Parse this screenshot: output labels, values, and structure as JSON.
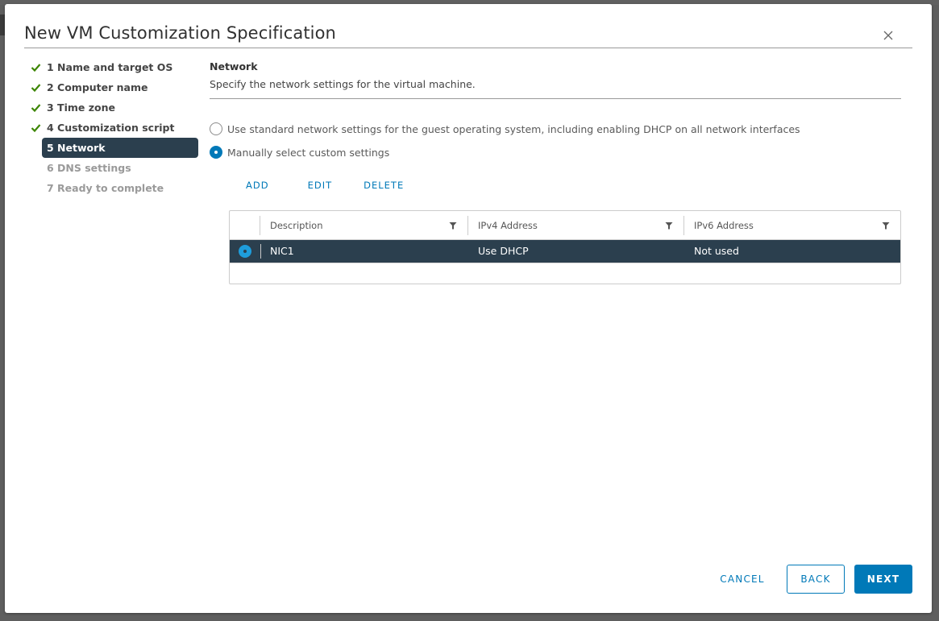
{
  "dialog": {
    "title": "New VM Customization Specification",
    "close_icon": "close-icon"
  },
  "steps": [
    {
      "label": "1 Name and target OS",
      "status": "complete"
    },
    {
      "label": "2 Computer name",
      "status": "complete"
    },
    {
      "label": "3 Time zone",
      "status": "complete"
    },
    {
      "label": "4 Customization script",
      "status": "complete"
    },
    {
      "label": "5 Network",
      "status": "active"
    },
    {
      "label": "6 DNS settings",
      "status": "disabled"
    },
    {
      "label": "7 Ready to complete",
      "status": "disabled"
    }
  ],
  "section": {
    "title": "Network",
    "description": "Specify the network settings for the virtual machine."
  },
  "options": [
    {
      "label": "Use standard network settings for the guest operating system, including enabling DHCP on all network interfaces",
      "checked": false
    },
    {
      "label": "Manually select custom settings",
      "checked": true
    }
  ],
  "actions": {
    "add": "ADD",
    "edit": "EDIT",
    "delete": "DELETE"
  },
  "grid": {
    "columns": [
      "Description",
      "IPv4 Address",
      "IPv6 Address"
    ],
    "rows": [
      {
        "selected": true,
        "description": "NIC1",
        "ipv4": "Use DHCP",
        "ipv6": "Not used"
      }
    ]
  },
  "footer": {
    "cancel": "CANCEL",
    "back": "BACK",
    "next": "NEXT"
  },
  "colors": {
    "accent": "#0079b8",
    "active_step_bg": "#2b3f4e",
    "check_green": "#3c8500"
  }
}
